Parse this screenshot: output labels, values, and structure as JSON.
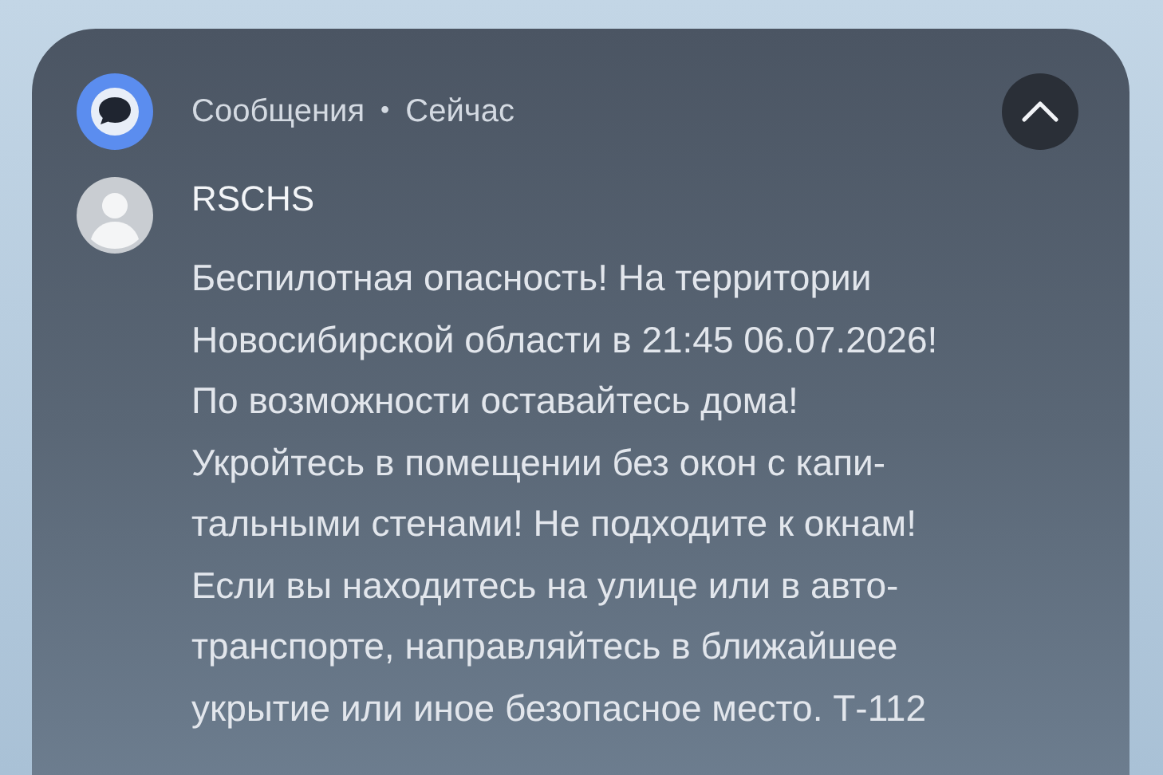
{
  "notification": {
    "app_name": "Сообщения",
    "separator": "•",
    "time": "Сейчас",
    "expanded": true,
    "sender": "RSCHS",
    "body_lines": [
      "Беспилотная опасность! На территории",
      "Новосибирской области в 21:45 06.07.2026!",
      "По возможности оставайтесь дома!",
      "Укройтесь в помещении без окон с капи-",
      "тальными стенами! Не подходите к окнам!",
      "Если вы находитесь на улице или в авто-",
      "транспорте, направляйтесь в ближайшее",
      "укрытие или иное безопасное место. Т-112"
    ]
  }
}
